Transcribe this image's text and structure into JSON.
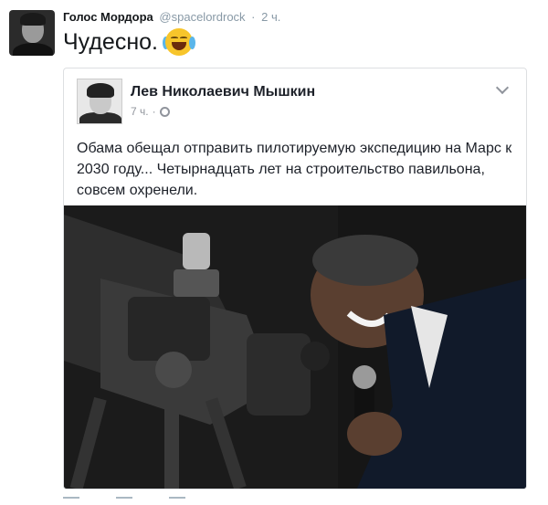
{
  "tweet": {
    "author_name": "Голос Мордора",
    "author_handle": "@spacelordrock",
    "separator": "·",
    "time": "2 ч.",
    "text": "Чудесно.",
    "emoji_icon": "face-with-tears-of-joy-icon"
  },
  "card": {
    "author_name": "Лев Николаевич Мышкин",
    "time": "7 ч.",
    "separator": "·",
    "privacy_icon": "globe-icon",
    "menu_icon": "chevron-down-icon",
    "text": "Обама обещал отправить пилотируемую экспедицию на Марс к 2030 году... Четырнадцать лет на строительство павильона, совсем охренели."
  },
  "colors": {
    "name": "#14171a",
    "muted": "#8899a6",
    "card_border": "#dddfe2",
    "card_muted": "#90949c"
  }
}
